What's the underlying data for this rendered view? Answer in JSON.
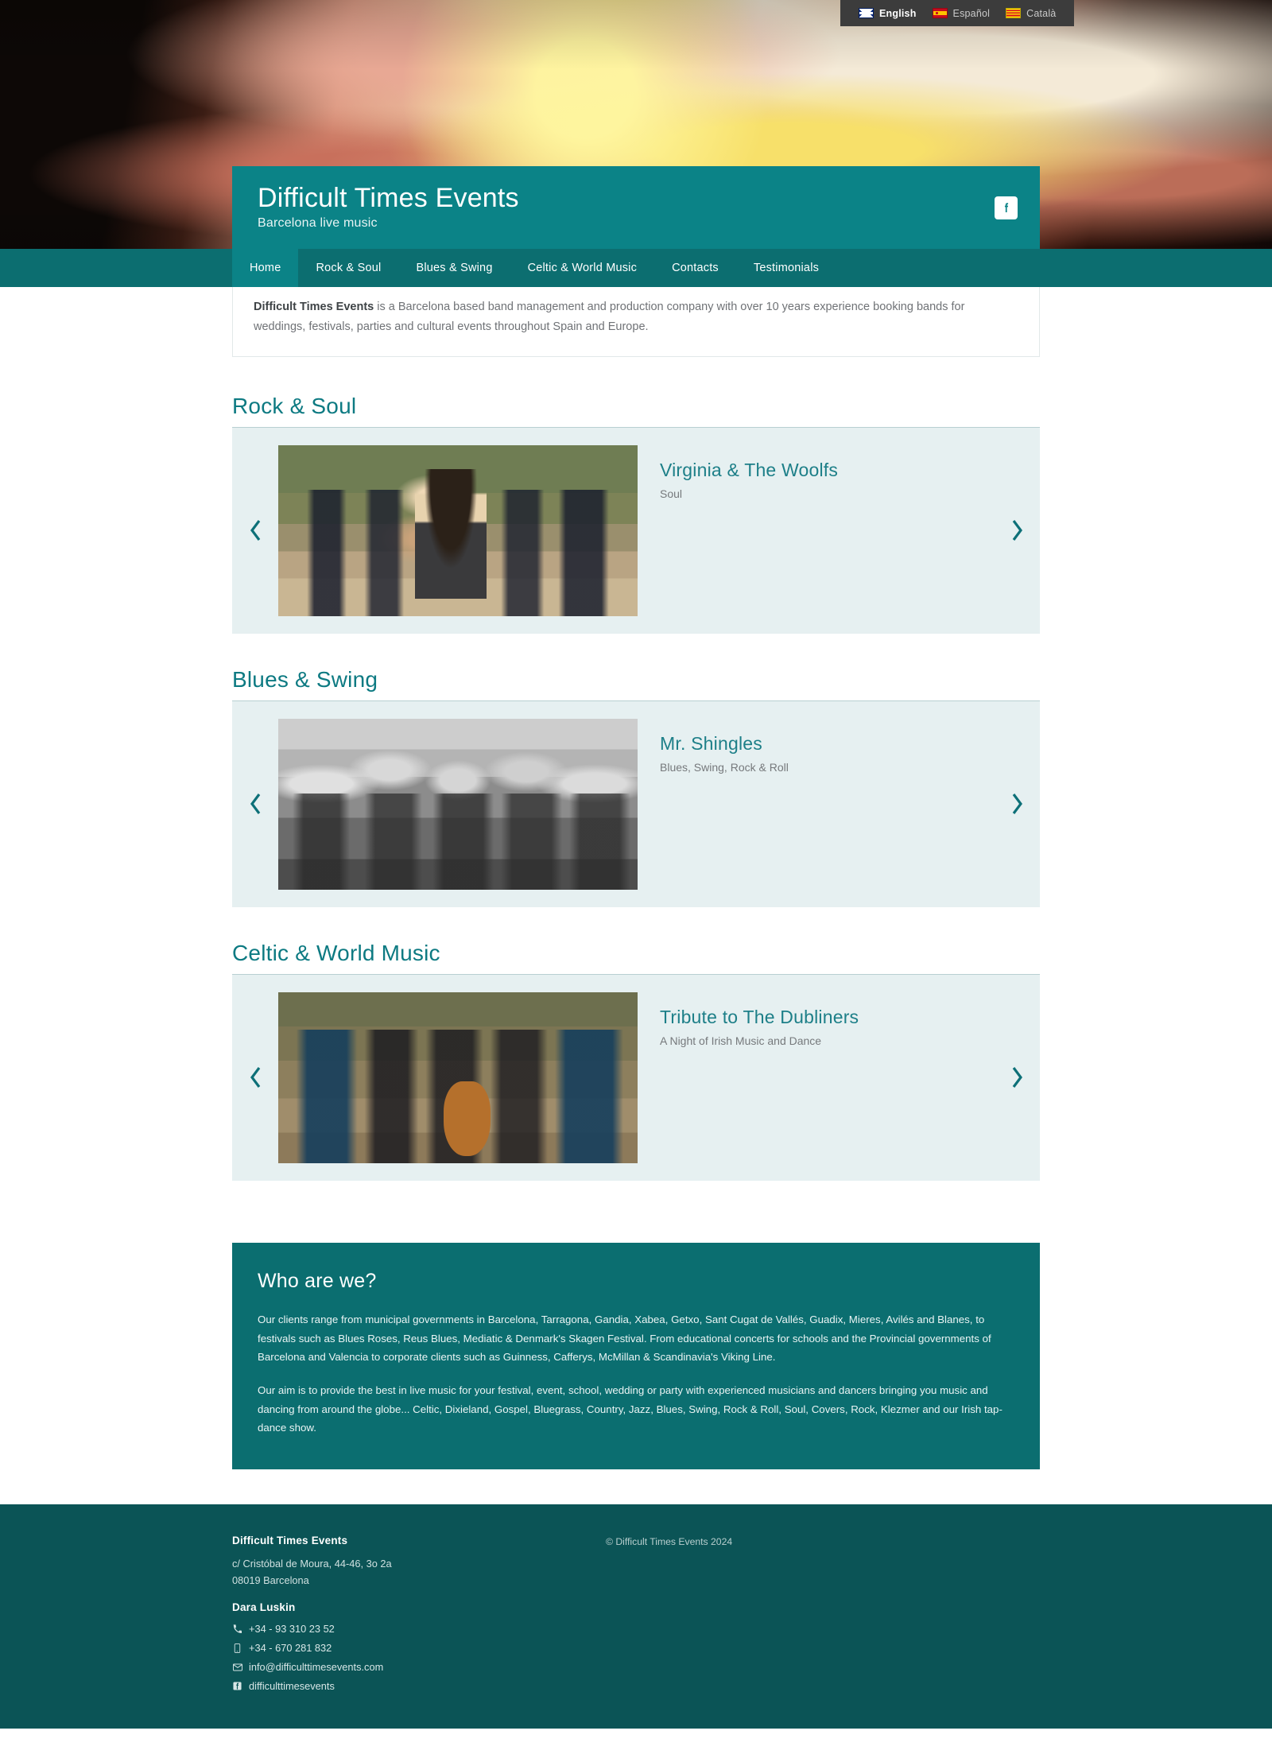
{
  "lang_bar": {
    "items": [
      {
        "label": "English",
        "flag": "uk-flag-icon",
        "active": true
      },
      {
        "label": "Español",
        "flag": "spain-flag-icon",
        "active": false
      },
      {
        "label": "Català",
        "flag": "catalonia-flag-icon",
        "active": false
      }
    ]
  },
  "header": {
    "title": "Difficult Times Events",
    "tagline": "Barcelona live music",
    "facebook_icon": "facebook-icon"
  },
  "nav": {
    "items": [
      {
        "label": "Home",
        "active": true
      },
      {
        "label": "Rock & Soul",
        "active": false
      },
      {
        "label": "Blues & Swing",
        "active": false
      },
      {
        "label": "Celtic & World Music",
        "active": false
      },
      {
        "label": "Contacts",
        "active": false
      },
      {
        "label": "Testimonials",
        "active": false
      }
    ]
  },
  "intro": {
    "strong": "Difficult Times Events",
    "rest": " is a Barcelona based band management and production company with over 10 years experience booking bands for weddings, festivals, parties and cultural events throughout Spain and Europe."
  },
  "sections": [
    {
      "title": "Rock & Soul",
      "band_name": "Virginia & The Woolfs",
      "band_genre": "Soul",
      "prev_icon": "chevron-left-icon",
      "next_icon": "chevron-right-icon"
    },
    {
      "title": "Blues & Swing",
      "band_name": "Mr. Shingles",
      "band_genre": "Blues, Swing, Rock & Roll",
      "prev_icon": "chevron-left-icon",
      "next_icon": "chevron-right-icon"
    },
    {
      "title": "Celtic & World Music",
      "band_name": "Tribute to The Dubliners",
      "band_genre": "A Night of Irish Music and Dance",
      "prev_icon": "chevron-left-icon",
      "next_icon": "chevron-right-icon"
    }
  ],
  "who": {
    "title": "Who are we?",
    "paragraph1": "Our clients range from municipal governments in Barcelona, Tarragona, Gandia, Xabea, Getxo, Sant Cugat de Vallés, Guadix, Mieres, Avilés and Blanes, to festivals such as Blues Roses, Reus Blues, Mediatic & Denmark's Skagen Festival. From educational concerts for schools and the Provincial governments of Barcelona and Valencia to corporate clients such as Guinness, Cafferys, McMillan & Scandinavia's Viking Line.",
    "paragraph2": "Our aim is to provide the best in live music for your festival, event, school, wedding or party with experienced musicians and dancers bringing you music and dancing from around the globe... Celtic, Dixieland, Gospel, Bluegrass, Country, Jazz, Blues, Swing, Rock & Roll, Soul, Covers, Rock, Klezmer and our Irish tap-dance show."
  },
  "footer": {
    "company": "Difficult Times Events",
    "address_line1": "c/ Cristóbal de Moura, 44-46, 3o 2a",
    "address_line2": "08019 Barcelona",
    "contact_name": "Dara Luskin",
    "phone": "+34 - 93 310 23 52",
    "mobile": "+34 - 670 281 832",
    "email": "info@difficulttimesevents.com",
    "facebook": "difficulttimesevents",
    "phone_icon": "phone-icon",
    "mobile_icon": "mobile-icon",
    "email_icon": "envelope-icon",
    "facebook_icon": "facebook-icon",
    "copyright": "© Difficult Times Events 2024"
  },
  "colors": {
    "teal_header": "#0b8387",
    "teal_nav": "#0c6e70",
    "teal_dark": "#0b5456",
    "heading_teal": "#0d7a82",
    "panel_light": "#e6f0f1"
  }
}
